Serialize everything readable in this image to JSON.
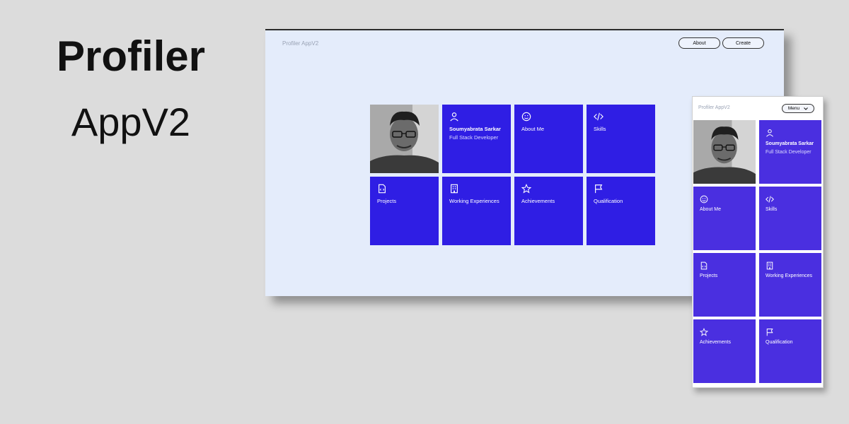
{
  "hero": {
    "line1": "Profiler",
    "line2": "AppV2"
  },
  "desktop": {
    "brand": "Profiler AppV2",
    "nav": {
      "about": "About",
      "create": "Create"
    },
    "profile": {
      "name": "Soumyabrata Sarkar",
      "role": "Full Stack Developer"
    },
    "tiles": [
      {
        "label": "About Me",
        "icon": "smile-icon"
      },
      {
        "label": "Skills",
        "icon": "code-icon"
      },
      {
        "label": "Projects",
        "icon": "file-code-icon"
      },
      {
        "label": "Working Experiences",
        "icon": "building-icon"
      },
      {
        "label": "Achievements",
        "icon": "star-icon"
      },
      {
        "label": "Qualification",
        "icon": "flag-icon"
      }
    ]
  },
  "mobile": {
    "brand": "Profiler AppV2",
    "menu": "Menu",
    "profile": {
      "name": "Soumyabrata Sarkar",
      "role": "Full Stack Developer"
    },
    "tiles": [
      {
        "label": "About Me"
      },
      {
        "label": "Skills"
      },
      {
        "label": "Projects"
      },
      {
        "label": "Working Experiences"
      },
      {
        "label": "Achievements"
      },
      {
        "label": "Qualification"
      }
    ]
  },
  "colors": {
    "tile_desktop": "#2f1ee4",
    "tile_mobile": "#4a2fe0",
    "page_bg": "#dcdcdc",
    "desktop_bg": "#e4ecfb"
  }
}
